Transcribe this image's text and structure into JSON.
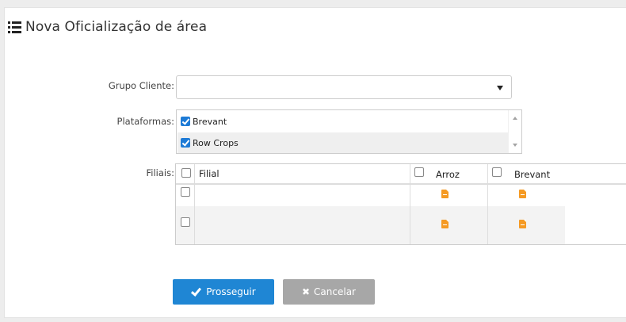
{
  "page": {
    "title": "Nova Oficialização de área",
    "title_icon": "list-icon"
  },
  "form": {
    "grupo_cliente": {
      "label": "Grupo Cliente:",
      "value": ""
    },
    "plataformas": {
      "label": "Plataformas:",
      "items": [
        {
          "label": "Brevant",
          "checked": true
        },
        {
          "label": "Row Crops",
          "checked": true
        }
      ]
    },
    "filiais": {
      "label": "Filiais:",
      "columns": [
        "Filial",
        "Arroz",
        "Brevant"
      ],
      "rows": [
        {
          "filial": "",
          "arroz_icon": "document-icon",
          "brevant_icon": "document-icon"
        },
        {
          "filial": "",
          "arroz_icon": "document-icon",
          "brevant_icon": "document-icon"
        }
      ]
    }
  },
  "actions": {
    "submit_label": "Prosseguir",
    "cancel_label": "Cancelar"
  },
  "colors": {
    "primary": "#1f86d4",
    "secondary": "#a7a7a7",
    "checkbox": "#1e7bd6",
    "doc_icon": "#f59a23"
  }
}
